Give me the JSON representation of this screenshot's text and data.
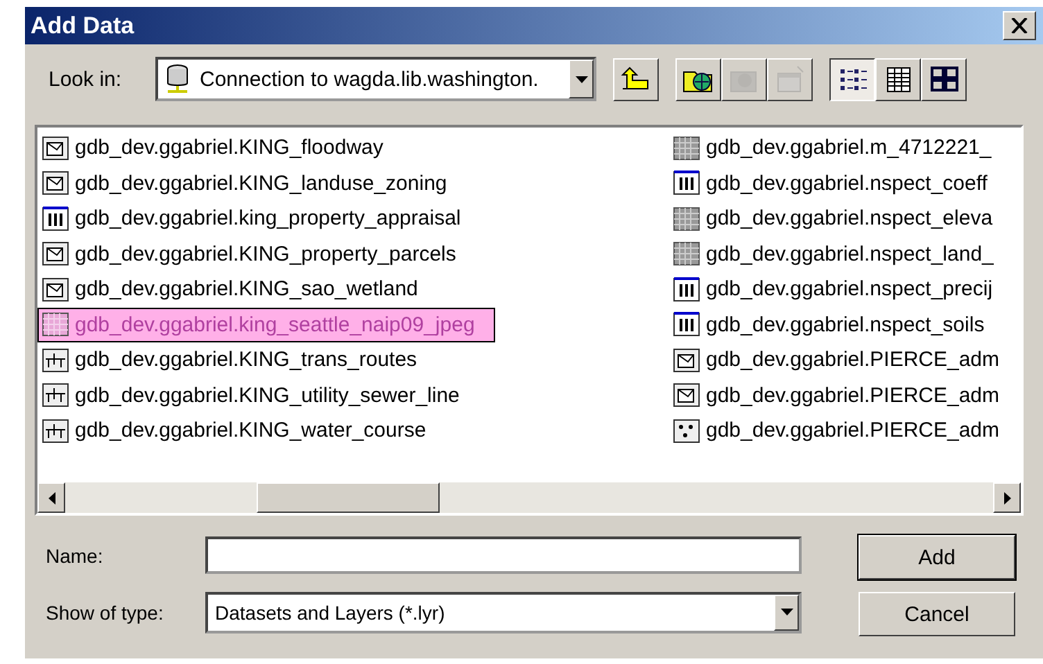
{
  "window": {
    "title": "Add Data"
  },
  "look_in": {
    "label": "Look in:",
    "value": "Connection to wagda.lib.washington."
  },
  "toolbar_buttons": [
    {
      "kind": "up",
      "disabled": false
    },
    {
      "kind": "connect",
      "disabled": false
    },
    {
      "kind": "disconnect",
      "disabled": true
    },
    {
      "kind": "properties",
      "disabled": true
    }
  ],
  "view_buttons": [
    {
      "kind": "list",
      "selected": true
    },
    {
      "kind": "details",
      "selected": false
    },
    {
      "kind": "thumbnails",
      "selected": false
    }
  ],
  "items": [
    {
      "name": "gdb_dev.ggabriel.KING_floodway",
      "kind": "polygon",
      "selected": false
    },
    {
      "name": "gdb_dev.ggabriel.KING_landuse_zoning",
      "kind": "polygon",
      "selected": false
    },
    {
      "name": "gdb_dev.ggabriel.king_property_appraisal",
      "kind": "table",
      "selected": false
    },
    {
      "name": "gdb_dev.ggabriel.KING_property_parcels",
      "kind": "polygon",
      "selected": false
    },
    {
      "name": "gdb_dev.ggabriel.KING_sao_wetland",
      "kind": "polygon",
      "selected": false
    },
    {
      "name": "gdb_dev.ggabriel.king_seattle_naip09_jpeg",
      "kind": "raster",
      "selected": true
    },
    {
      "name": "gdb_dev.ggabriel.KING_trans_routes",
      "kind": "line",
      "selected": false
    },
    {
      "name": "gdb_dev.ggabriel.KING_utility_sewer_line",
      "kind": "line",
      "selected": false
    },
    {
      "name": "gdb_dev.ggabriel.KING_water_course",
      "kind": "line",
      "selected": false
    },
    {
      "name": "gdb_dev.ggabriel.m_4712221_",
      "kind": "raster",
      "selected": false
    },
    {
      "name": "gdb_dev.ggabriel.nspect_coeff",
      "kind": "table",
      "selected": false
    },
    {
      "name": "gdb_dev.ggabriel.nspect_eleva",
      "kind": "raster",
      "selected": false
    },
    {
      "name": "gdb_dev.ggabriel.nspect_land_",
      "kind": "raster",
      "selected": false
    },
    {
      "name": "gdb_dev.ggabriel.nspect_precij",
      "kind": "table",
      "selected": false
    },
    {
      "name": "gdb_dev.ggabriel.nspect_soils",
      "kind": "table",
      "selected": false
    },
    {
      "name": "gdb_dev.ggabriel.PIERCE_adm",
      "kind": "polygon",
      "selected": false
    },
    {
      "name": "gdb_dev.ggabriel.PIERCE_adm",
      "kind": "polygon",
      "selected": false
    },
    {
      "name": "gdb_dev.ggabriel.PIERCE_adm",
      "kind": "point",
      "selected": false
    }
  ],
  "name_field": {
    "label": "Name:"
  },
  "type_field": {
    "label": "Show of type:",
    "value": "Datasets and Layers (*.lyr)"
  },
  "buttons": [
    {
      "label": "Add",
      "default": true
    },
    {
      "label": "Cancel",
      "default": false
    }
  ]
}
